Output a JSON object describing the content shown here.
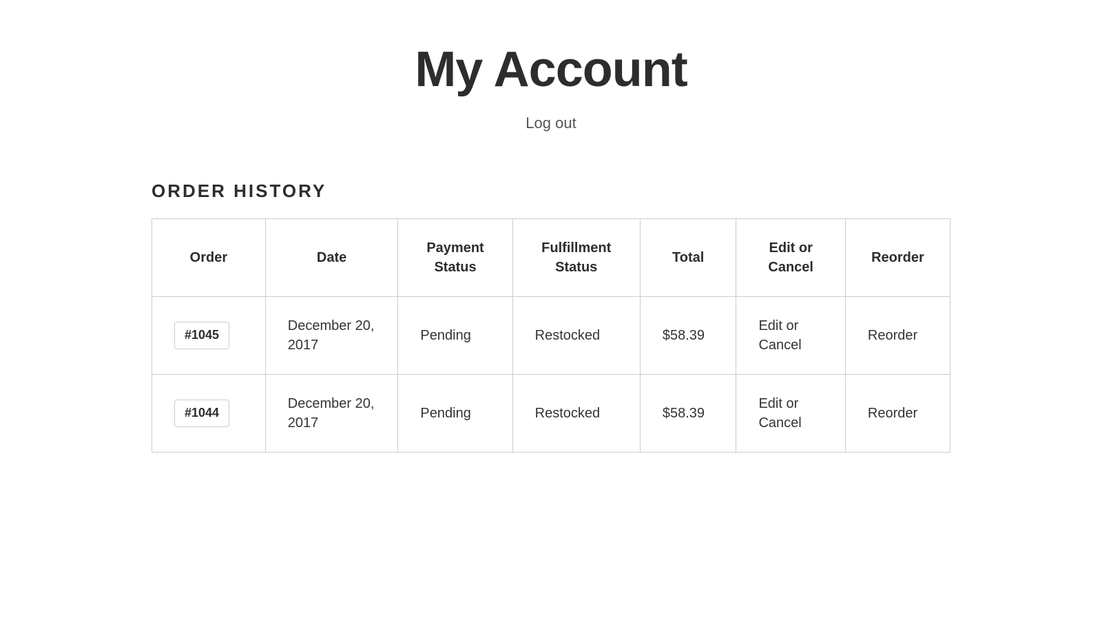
{
  "page": {
    "title": "My Account",
    "logout_label": "Log out"
  },
  "order_history": {
    "section_title": "ORDER HISTORY",
    "columns": [
      {
        "key": "order",
        "label": "Order"
      },
      {
        "key": "date",
        "label": "Date"
      },
      {
        "key": "payment_status",
        "label": "Payment Status"
      },
      {
        "key": "fulfillment_status",
        "label": "Fulfillment Status"
      },
      {
        "key": "total",
        "label": "Total"
      },
      {
        "key": "edit_cancel",
        "label": "Edit or Cancel"
      },
      {
        "key": "reorder",
        "label": "Reorder"
      }
    ],
    "rows": [
      {
        "order_number": "#1045",
        "date": "December 20, 2017",
        "payment_status": "Pending",
        "fulfillment_status": "Restocked",
        "total": "$58.39",
        "edit_cancel_label": "Edit or Cancel",
        "reorder_label": "Reorder"
      },
      {
        "order_number": "#1044",
        "date": "December 20, 2017",
        "payment_status": "Pending",
        "fulfillment_status": "Restocked",
        "total": "$58.39",
        "edit_cancel_label": "Edit or Cancel",
        "reorder_label": "Reorder"
      }
    ]
  }
}
